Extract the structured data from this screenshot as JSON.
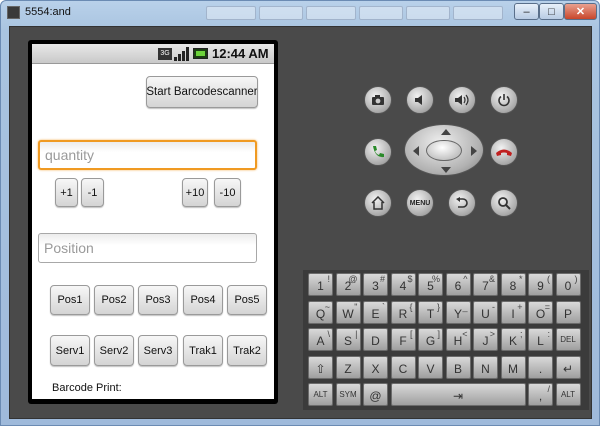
{
  "window": {
    "title": "5554:and",
    "minimize": "–",
    "maximize": "□",
    "close": "✕"
  },
  "status": {
    "network": "3G",
    "time": "12:44 AM"
  },
  "app": {
    "scan_button": "Start Barcodescanner",
    "quantity_placeholder": "quantity",
    "qty_buttons": [
      "+1",
      "-1",
      "+10",
      "-10"
    ],
    "position_placeholder": "Position",
    "pos_buttons": [
      "Pos1",
      "Pos2",
      "Pos3",
      "Pos4",
      "Pos5"
    ],
    "serv_buttons": [
      "Serv1",
      "Serv2",
      "Serv3",
      "Trak1",
      "Trak2"
    ],
    "barcode_label": "Barcode Print:"
  },
  "controls": {
    "menu_label": "MENU"
  },
  "keyboard": {
    "row1": [
      [
        "1",
        "!"
      ],
      [
        "2",
        "@"
      ],
      [
        "3",
        "#"
      ],
      [
        "4",
        "$"
      ],
      [
        "5",
        "%"
      ],
      [
        "6",
        "^"
      ],
      [
        "7",
        "&"
      ],
      [
        "8",
        "*"
      ],
      [
        "9",
        "("
      ],
      [
        "0",
        ")"
      ]
    ],
    "row2": [
      [
        "Q",
        "~"
      ],
      [
        "W",
        "\""
      ],
      [
        "E",
        "`"
      ],
      [
        "R",
        "{"
      ],
      [
        "T",
        "}"
      ],
      [
        "Y",
        "_"
      ],
      [
        "U",
        "-"
      ],
      [
        "I",
        "+"
      ],
      [
        "O",
        "="
      ],
      [
        "P",
        ""
      ]
    ],
    "row3": [
      [
        "A",
        "\\"
      ],
      [
        "S",
        "|"
      ],
      [
        "D",
        ""
      ],
      [
        "F",
        "["
      ],
      [
        "G",
        "]"
      ],
      [
        "H",
        "<"
      ],
      [
        "J",
        ">"
      ],
      [
        "K",
        ";"
      ],
      [
        "L",
        ":"
      ]
    ],
    "del": "DEL",
    "row4": [
      [
        "Z",
        ""
      ],
      [
        "X",
        ""
      ],
      [
        "C",
        ""
      ],
      [
        "V",
        ""
      ],
      [
        "B",
        ""
      ],
      [
        "N",
        ""
      ],
      [
        "M",
        ""
      ],
      [
        ".",
        ""
      ]
    ],
    "alt": "ALT",
    "sym": "SYM",
    "at": "@",
    "space_sym": "⇥",
    "right_arrow": "→",
    "slash": "/",
    "question": "?",
    "comma": ","
  }
}
